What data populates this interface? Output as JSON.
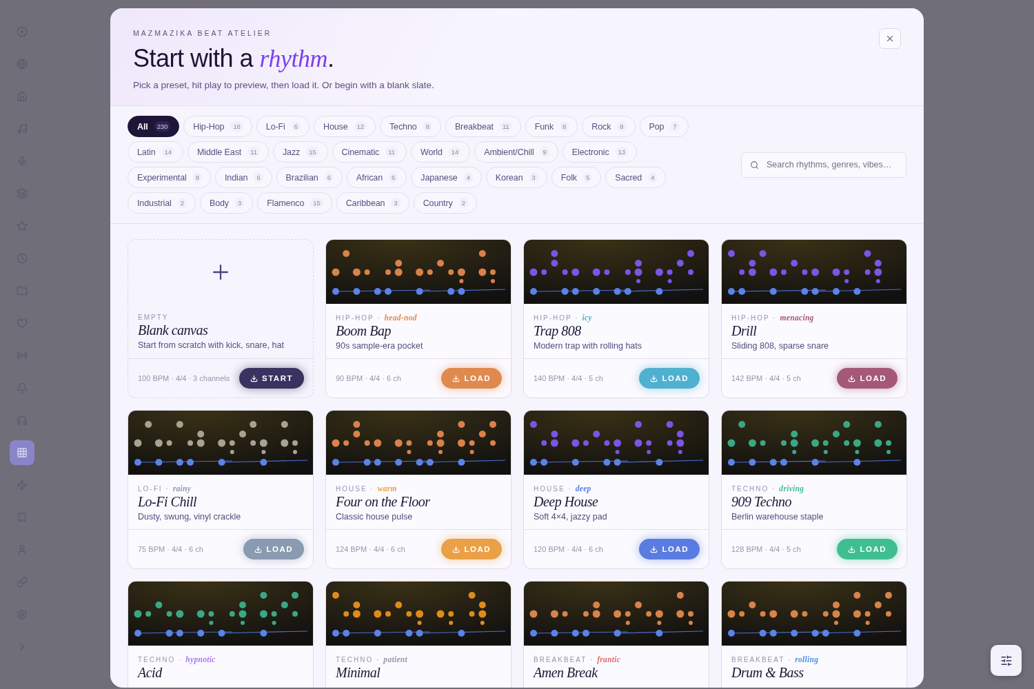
{
  "sidebar": {
    "items": [
      {
        "selected": false
      },
      {
        "selected": false
      },
      {
        "selected": false
      },
      {
        "selected": false
      },
      {
        "selected": false
      },
      {
        "selected": false
      },
      {
        "selected": false
      },
      {
        "selected": false
      },
      {
        "selected": false
      },
      {
        "selected": false
      },
      {
        "selected": false
      },
      {
        "selected": false
      },
      {
        "selected": false
      },
      {
        "selected": true
      },
      {
        "selected": false
      },
      {
        "selected": false
      },
      {
        "selected": false
      },
      {
        "selected": false
      },
      {
        "selected": false
      },
      {
        "selected": false
      }
    ]
  },
  "header": {
    "eyebrow": "MAZMAZIKA BEAT ATELIER",
    "title": "Start with a *rhythm*.",
    "subtitle": "Pick a preset, hit play to preview, then load it. Or begin with a blank slate."
  },
  "filters": [
    {
      "label": "All",
      "count": "230",
      "selected": true
    },
    {
      "label": "Hip-Hop",
      "count": "16",
      "selected": false
    },
    {
      "label": "Lo-Fi",
      "count": "6",
      "selected": false
    },
    {
      "label": "House",
      "count": "12",
      "selected": false
    },
    {
      "label": "Techno",
      "count": "8",
      "selected": false
    },
    {
      "label": "Breakbeat",
      "count": "11",
      "selected": false
    },
    {
      "label": "Funk",
      "count": "8",
      "selected": false
    },
    {
      "label": "Rock",
      "count": "8",
      "selected": false
    },
    {
      "label": "Pop",
      "count": "7",
      "selected": false
    },
    {
      "label": "Latin",
      "count": "14",
      "selected": false
    },
    {
      "label": "Middle East",
      "count": "11",
      "selected": false
    },
    {
      "label": "Jazz",
      "count": "15",
      "selected": false
    },
    {
      "label": "Cinematic",
      "count": "11",
      "selected": false
    },
    {
      "label": "World",
      "count": "14",
      "selected": false
    },
    {
      "label": "Ambient/Chill",
      "count": "9",
      "selected": false
    },
    {
      "label": "Electronic",
      "count": "13",
      "selected": false
    },
    {
      "label": "Experimental",
      "count": "8",
      "selected": false
    },
    {
      "label": "Indian",
      "count": "6",
      "selected": false
    },
    {
      "label": "Brazilian",
      "count": "6",
      "selected": false
    },
    {
      "label": "African",
      "count": "6",
      "selected": false
    },
    {
      "label": "Japanese",
      "count": "4",
      "selected": false
    },
    {
      "label": "Korean",
      "count": "3",
      "selected": false
    },
    {
      "label": "Folk",
      "count": "5",
      "selected": false
    },
    {
      "label": "Sacred",
      "count": "4",
      "selected": false
    },
    {
      "label": "Industrial",
      "count": "2",
      "selected": false
    },
    {
      "label": "Body",
      "count": "3",
      "selected": false
    },
    {
      "label": "Flamenco",
      "count": "15",
      "selected": false
    },
    {
      "label": "Caribbean",
      "count": "3",
      "selected": false
    },
    {
      "label": "Country",
      "count": "2",
      "selected": false
    }
  ],
  "search": {
    "placeholder": "Search rhythms, genres, vibes…"
  },
  "cards": [
    {
      "kind": "empty",
      "genre": "EMPTY",
      "title": "Blank canvas",
      "description": "Start from scratch with kick, snare, hat",
      "meta": "100 BPM · 4/4 · 3 channels",
      "button": "START",
      "color": "#3a3260"
    },
    {
      "kind": "preset",
      "genre": "HIP-HOP ·",
      "mood": "head-nod",
      "title": "Boom Bap",
      "description": "90s sample-era pocket",
      "meta": "90 BPM · 4/4 · 6 ch",
      "button": "LOAD",
      "color": "#e0894f",
      "pattern": {
        "color": "#d9824a"
      }
    },
    {
      "kind": "preset",
      "genre": "HIP-HOP ·",
      "mood": "icy",
      "title": "Trap 808",
      "description": "Modern trap with rolling hats",
      "meta": "140 BPM · 4/4 · 5 ch",
      "button": "LOAD",
      "color": "#4fb0d0",
      "pattern": {
        "color": "#7a55e6"
      }
    },
    {
      "kind": "preset",
      "genre": "HIP-HOP ·",
      "mood": "menacing",
      "title": "Drill",
      "description": "Sliding 808, sparse snare",
      "meta": "142 BPM · 4/4 · 5 ch",
      "button": "LOAD",
      "color": "#a5587a",
      "pattern": {
        "color": "#7a55e6"
      }
    },
    {
      "kind": "preset",
      "genre": "LO-FI ·",
      "mood": "rainy",
      "title": "Lo-Fi Chill",
      "description": "Dusty, swung, vinyl crackle",
      "meta": "75 BPM · 4/4 · 6 ch",
      "button": "LOAD",
      "color": "#8a9ab0",
      "pattern": {
        "color": "#a8a290"
      }
    },
    {
      "kind": "preset",
      "genre": "HOUSE ·",
      "mood": "warm",
      "title": "Four on the Floor",
      "description": "Classic house pulse",
      "meta": "124 BPM · 4/4 · 6 ch",
      "button": "LOAD",
      "color": "#eaa046",
      "pattern": {
        "color": "#d9824a"
      }
    },
    {
      "kind": "preset",
      "genre": "HOUSE ·",
      "mood": "deep",
      "title": "Deep House",
      "description": "Soft 4×4, jazzy pad",
      "meta": "120 BPM · 4/4 · 6 ch",
      "button": "LOAD",
      "color": "#5a7ce0",
      "pattern": {
        "color": "#7a55e6"
      }
    },
    {
      "kind": "preset",
      "genre": "TECHNO ·",
      "mood": "driving",
      "title": "909 Techno",
      "description": "Berlin warehouse staple",
      "meta": "128 BPM · 4/4 · 5 ch",
      "button": "LOAD",
      "color": "#3fbf8f",
      "pattern": {
        "color": "#3aa885"
      }
    },
    {
      "kind": "preset",
      "genre": "TECHNO ·",
      "mood": "hypnotic",
      "title": "Acid",
      "color": "#a57cf0",
      "pattern": {
        "color": "#3aa885"
      }
    },
    {
      "kind": "preset",
      "genre": "TECHNO ·",
      "mood": "patient",
      "title": "Minimal",
      "color": "#9a96a8",
      "pattern": {
        "color": "#e08a1c"
      }
    },
    {
      "kind": "preset",
      "genre": "BREAKBEAT ·",
      "mood": "frantic",
      "title": "Amen Break",
      "color": "#e06a6a",
      "pattern": {
        "color": "#d9824a"
      }
    },
    {
      "kind": "preset",
      "genre": "BREAKBEAT ·",
      "mood": "rolling",
      "title": "Drum & Bass",
      "color": "#4f8fe0",
      "pattern": {
        "color": "#d9824a"
      }
    }
  ]
}
